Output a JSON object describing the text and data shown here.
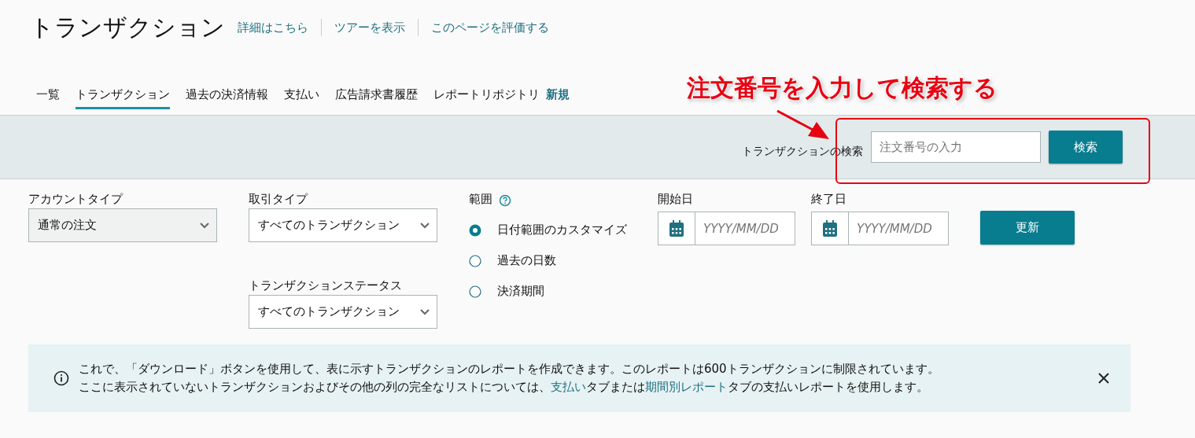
{
  "header": {
    "title": "トランザクション",
    "links": [
      "詳細はこちら",
      "ツアーを表示",
      "このページを評価する"
    ]
  },
  "tabs": [
    {
      "label": "一覧",
      "selected": false
    },
    {
      "label": "トランザクション",
      "selected": true
    },
    {
      "label": "過去の決済情報",
      "selected": false
    },
    {
      "label": "支払い",
      "selected": false
    },
    {
      "label": "広告請求書履歴",
      "selected": false
    },
    {
      "label": "レポートリポジトリ",
      "selected": false,
      "badge": "新規"
    }
  ],
  "annotation": {
    "text": "注文番号を入力して検索する"
  },
  "search": {
    "label": "トランザクションの検索",
    "placeholder": "注文番号の入力",
    "button": "検索"
  },
  "filters": {
    "account_type": {
      "label": "アカウントタイプ",
      "value": "通常の注文"
    },
    "transaction_type": {
      "label": "取引タイプ",
      "value": "すべてのトランザクション"
    },
    "transaction_status": {
      "label": "トランザクションステータス",
      "value": "すべてのトランザクション"
    },
    "range": {
      "label": "範囲",
      "options": [
        {
          "label": "日付範囲のカスタマイズ",
          "selected": true
        },
        {
          "label": "過去の日数",
          "selected": false
        },
        {
          "label": "決済期間",
          "selected": false
        }
      ]
    },
    "start_date": {
      "label": "開始日",
      "placeholder": "YYYY/MM/DD"
    },
    "end_date": {
      "label": "終了日",
      "placeholder": "YYYY/MM/DD"
    },
    "update_button": "更新"
  },
  "notice": {
    "lines": [
      [
        {
          "kind": "text",
          "text": "これで、「ダウンロード」ボタンを使用して、表に示すトランザクションのレポートを作成できます。このレポートは600トランザクションに制限されています。"
        }
      ],
      [
        {
          "kind": "text",
          "text": "ここに表示されていないトランザクションおよびその他の列の完全なリストについては、"
        },
        {
          "kind": "link",
          "text": "支払い"
        },
        {
          "kind": "text",
          "text": "タブまたは"
        },
        {
          "kind": "link",
          "text": "期間別レポート"
        },
        {
          "kind": "text",
          "text": "タブの支払いレポートを使用します。"
        }
      ]
    ]
  }
}
